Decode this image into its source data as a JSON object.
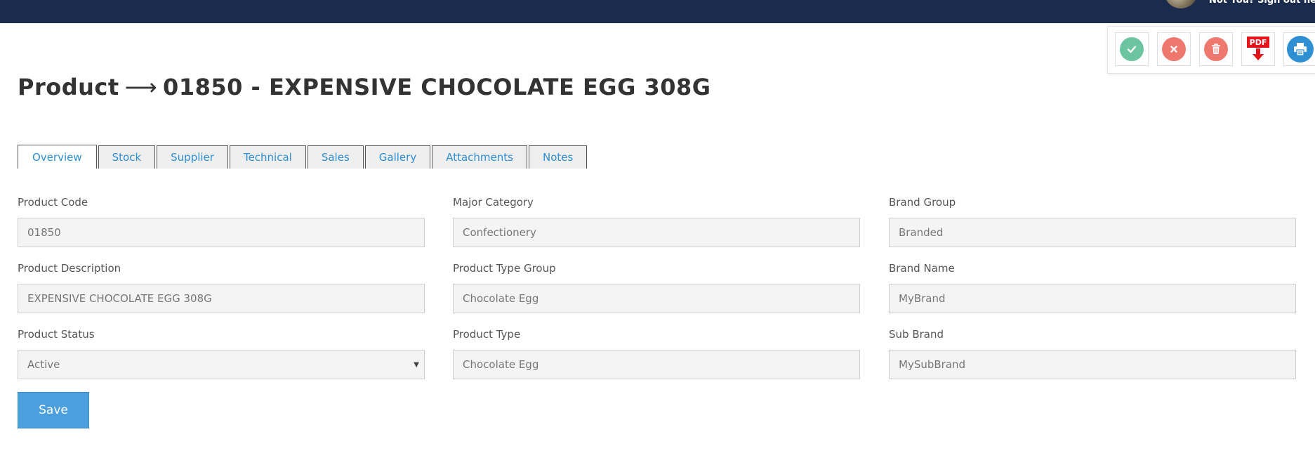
{
  "header": {
    "signout_text": "Not You? Sign out here"
  },
  "actions": [
    {
      "name": "approve",
      "icon": "check-icon",
      "color": "#6cc4a1"
    },
    {
      "name": "cancel",
      "icon": "x-icon",
      "color": "#ee776e"
    },
    {
      "name": "delete",
      "icon": "trash-icon",
      "color": "#ee776e"
    },
    {
      "name": "pdf",
      "icon": "pdf-download-icon",
      "color": "#e3141b",
      "label": "PDF"
    },
    {
      "name": "print",
      "icon": "printer-icon",
      "color": "#2e8fd3"
    }
  ],
  "page": {
    "title_prefix": "Product",
    "title_arrow": "⟶",
    "title_main": "01850 - EXPENSIVE CHOCOLATE EGG 308G"
  },
  "tabs": [
    "Overview",
    "Stock",
    "Supplier",
    "Technical",
    "Sales",
    "Gallery",
    "Attachments",
    "Notes"
  ],
  "active_tab": "Overview",
  "form": {
    "product_code": {
      "label": "Product Code",
      "value": "01850"
    },
    "product_description": {
      "label": "Product Description",
      "value": "EXPENSIVE CHOCOLATE EGG 308G"
    },
    "product_status": {
      "label": "Product Status",
      "value": "Active"
    },
    "major_category": {
      "label": "Major Category",
      "value": "Confectionery"
    },
    "product_type_group": {
      "label": "Product Type Group",
      "value": "Chocolate Egg"
    },
    "product_type": {
      "label": "Product Type",
      "value": "Chocolate Egg"
    },
    "brand_group": {
      "label": "Brand Group",
      "value": "Branded"
    },
    "brand_name": {
      "label": "Brand Name",
      "value": "MyBrand"
    },
    "sub_brand": {
      "label": "Sub Brand",
      "value": "MySubBrand"
    }
  },
  "save_label": "Save",
  "colors": {
    "topbar": "#1b2b4b",
    "accent": "#2e8fd3",
    "save_button": "#4a9fdc"
  }
}
